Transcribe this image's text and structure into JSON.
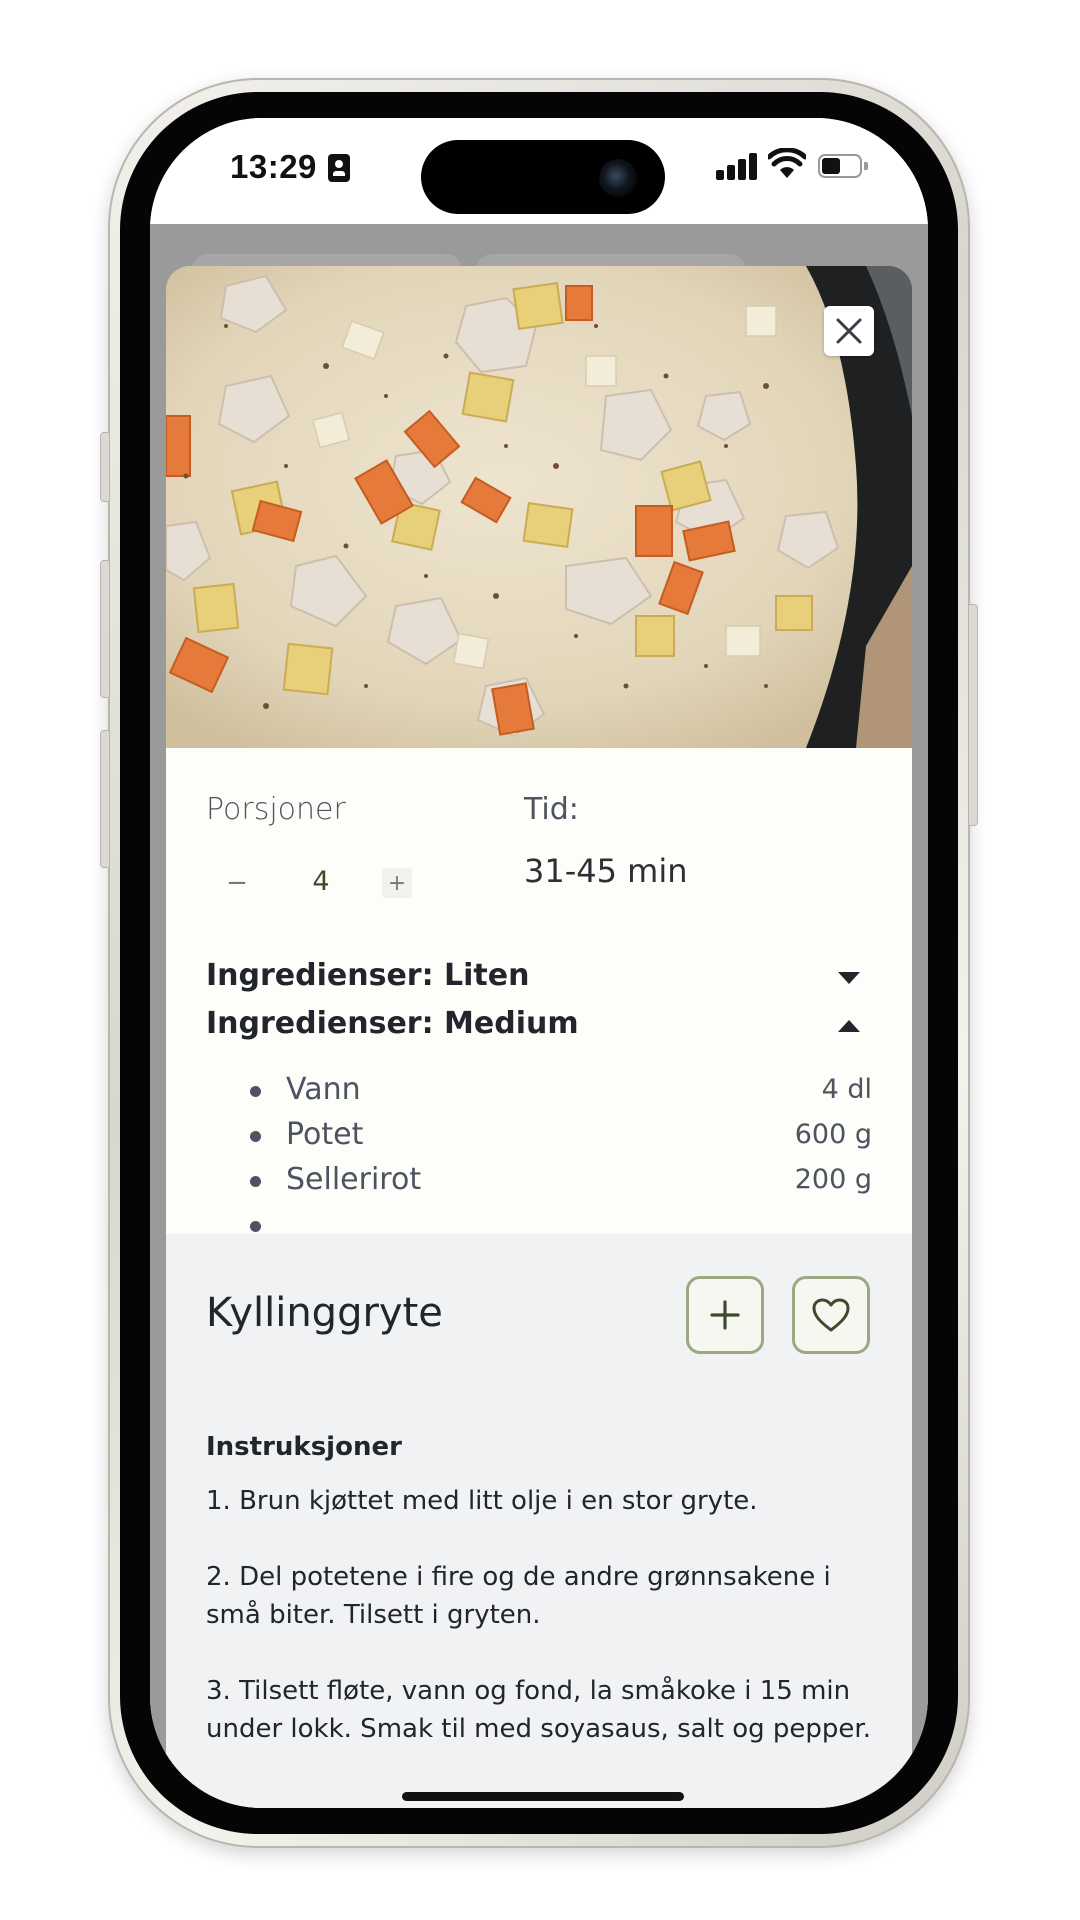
{
  "status_bar": {
    "time": "13:29"
  },
  "modal": {
    "close_icon": "close-icon",
    "servings": {
      "label": "Porsjoner",
      "value": "4",
      "minus": "−",
      "plus": "+"
    },
    "time": {
      "label": "Tid:",
      "value": "31-45 min"
    },
    "ingredient_sections": [
      {
        "label": "Ingredienser: Liten",
        "state": "collapsed"
      },
      {
        "label": "Ingredienser: Medium",
        "state": "expanded"
      }
    ],
    "ingredients": [
      {
        "name": "Vann",
        "amount": "4 dl"
      },
      {
        "name": "Potet",
        "amount": "600 g"
      },
      {
        "name": "Sellerirot",
        "amount": "200 g"
      }
    ]
  },
  "recipe": {
    "title": "Kyllinggryte",
    "add_icon": "plus-icon",
    "favorite_icon": "heart-icon",
    "instructions_heading": "Instruksjoner",
    "steps": [
      "1. Brun kjøttet med litt olje i en stor gryte.",
      "2. Del potetene i fire og de andre grønnsakene i små biter. Tilsett i gryten.",
      "3. Tilsett fløte, vann og fond, la småkoke i 15 min under lokk. Smak til med soyasaus, salt og pepper."
    ]
  },
  "colors": {
    "accent_border": "#9ca882",
    "accent_text": "#3d4b2b",
    "sheet_background": "#f1f2f4",
    "info_background": "#fdfdfa"
  }
}
